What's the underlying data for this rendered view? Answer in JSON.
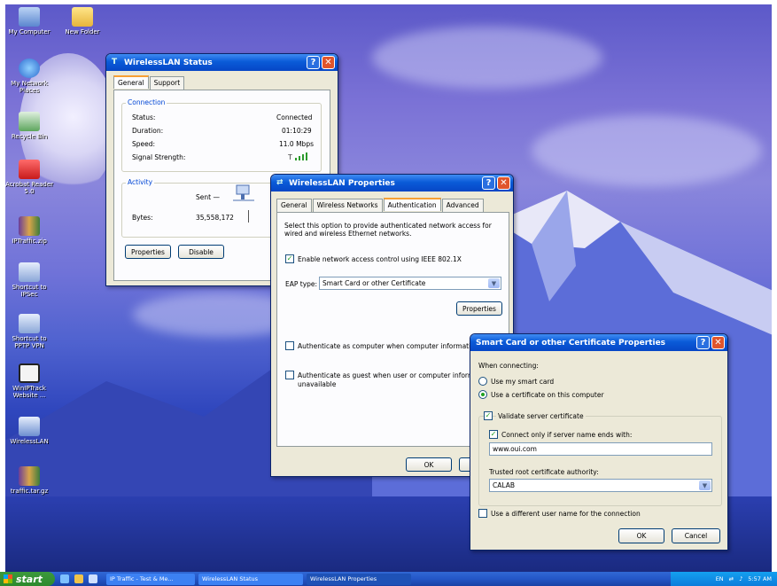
{
  "desktop_icons": [
    {
      "label": "My Computer"
    },
    {
      "label": "New Folder"
    },
    {
      "label": "My Network Places"
    },
    {
      "label": "Recycle Bin"
    },
    {
      "label": "Acrobat Reader 5.0"
    },
    {
      "label": "IPTraffic.zip"
    },
    {
      "label": "Shortcut to IPSec"
    },
    {
      "label": "Shortcut to PPTP VPN"
    },
    {
      "label": "WinIPTrack Website ..."
    },
    {
      "label": "WirelessLAN"
    },
    {
      "label": "traffic.tar.gz"
    }
  ],
  "status_window": {
    "title": "WirelessLAN Status",
    "tabs": [
      "General",
      "Support"
    ],
    "connection_label": "Connection",
    "status_label": "Status:",
    "status_value": "Connected",
    "duration_label": "Duration:",
    "duration_value": "01:10:29",
    "speed_label": "Speed:",
    "speed_value": "11.0 Mbps",
    "signal_label": "Signal Strength:",
    "activity_label": "Activity",
    "sent_label": "Sent —",
    "bytes_label": "Bytes:",
    "bytes_value": "35,558,172",
    "properties_button": "Properties",
    "disable_button": "Disable"
  },
  "properties_window": {
    "title": "WirelessLAN Properties",
    "tabs": [
      "General",
      "Wireless Networks",
      "Authentication",
      "Advanced"
    ],
    "description": "Select this option to provide authenticated network access for wired and wireless Ethernet networks.",
    "enable_label": "Enable network access control using IEEE 802.1X",
    "eap_label": "EAP type:",
    "eap_value": "Smart Card or other Certificate",
    "properties_button": "Properties",
    "auth_computer_label": "Authenticate as computer when computer information",
    "auth_guest_label": "Authenticate as guest when user or computer informati",
    "auth_guest_label2": "unavailable",
    "ok_button": "OK"
  },
  "smartcard_window": {
    "title": "Smart Card or other Certificate Properties",
    "when_connecting": "When connecting:",
    "use_smart_card": "Use my smart card",
    "use_certificate": "Use a certificate on this computer",
    "validate_server": "Validate server certificate",
    "connect_only": "Connect only if server name ends with:",
    "server_name": "www.oui.com",
    "trusted_root": "Trusted root certificate authority:",
    "trusted_value": "CALAB",
    "different_user": "Use a different user name for the connection",
    "ok_button": "OK",
    "cancel_button": "Cancel"
  },
  "taskbar": {
    "start": "start",
    "tasks": [
      "IP Traffic - Test & Me...",
      "WirelessLAN Status",
      "WirelessLAN Properties"
    ],
    "lang": "EN",
    "clock": "5:57 AM"
  }
}
